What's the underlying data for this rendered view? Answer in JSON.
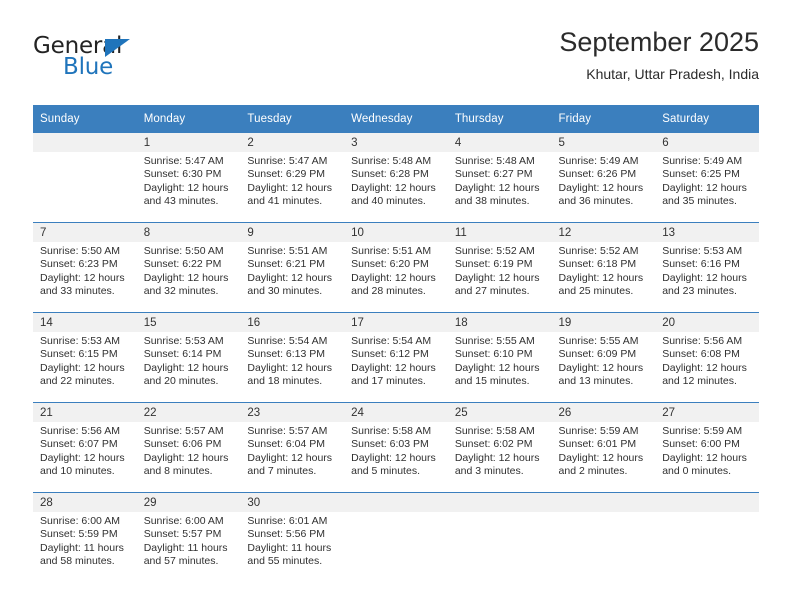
{
  "brand": {
    "line1": "General",
    "line2": "Blue",
    "triangle_icon": "triangle-icon",
    "color_dark": "#232323",
    "color_blue": "#1f74bb"
  },
  "header": {
    "title": "September 2025",
    "subtitle": "Khutar, Uttar Pradesh, India"
  },
  "theme": {
    "header_blue": "#3b7fbe",
    "daynum_band": "#f1f1f1",
    "text": "#303030"
  },
  "calendar": {
    "weekday_headers": [
      "Sunday",
      "Monday",
      "Tuesday",
      "Wednesday",
      "Thursday",
      "Friday",
      "Saturday"
    ],
    "weeks": [
      [
        {
          "day": "",
          "sunrise": "",
          "sunset": "",
          "daylight_1": "",
          "daylight_2": ""
        },
        {
          "day": "1",
          "sunrise": "Sunrise: 5:47 AM",
          "sunset": "Sunset: 6:30 PM",
          "daylight_1": "Daylight: 12 hours",
          "daylight_2": "and 43 minutes."
        },
        {
          "day": "2",
          "sunrise": "Sunrise: 5:47 AM",
          "sunset": "Sunset: 6:29 PM",
          "daylight_1": "Daylight: 12 hours",
          "daylight_2": "and 41 minutes."
        },
        {
          "day": "3",
          "sunrise": "Sunrise: 5:48 AM",
          "sunset": "Sunset: 6:28 PM",
          "daylight_1": "Daylight: 12 hours",
          "daylight_2": "and 40 minutes."
        },
        {
          "day": "4",
          "sunrise": "Sunrise: 5:48 AM",
          "sunset": "Sunset: 6:27 PM",
          "daylight_1": "Daylight: 12 hours",
          "daylight_2": "and 38 minutes."
        },
        {
          "day": "5",
          "sunrise": "Sunrise: 5:49 AM",
          "sunset": "Sunset: 6:26 PM",
          "daylight_1": "Daylight: 12 hours",
          "daylight_2": "and 36 minutes."
        },
        {
          "day": "6",
          "sunrise": "Sunrise: 5:49 AM",
          "sunset": "Sunset: 6:25 PM",
          "daylight_1": "Daylight: 12 hours",
          "daylight_2": "and 35 minutes."
        }
      ],
      [
        {
          "day": "7",
          "sunrise": "Sunrise: 5:50 AM",
          "sunset": "Sunset: 6:23 PM",
          "daylight_1": "Daylight: 12 hours",
          "daylight_2": "and 33 minutes."
        },
        {
          "day": "8",
          "sunrise": "Sunrise: 5:50 AM",
          "sunset": "Sunset: 6:22 PM",
          "daylight_1": "Daylight: 12 hours",
          "daylight_2": "and 32 minutes."
        },
        {
          "day": "9",
          "sunrise": "Sunrise: 5:51 AM",
          "sunset": "Sunset: 6:21 PM",
          "daylight_1": "Daylight: 12 hours",
          "daylight_2": "and 30 minutes."
        },
        {
          "day": "10",
          "sunrise": "Sunrise: 5:51 AM",
          "sunset": "Sunset: 6:20 PM",
          "daylight_1": "Daylight: 12 hours",
          "daylight_2": "and 28 minutes."
        },
        {
          "day": "11",
          "sunrise": "Sunrise: 5:52 AM",
          "sunset": "Sunset: 6:19 PM",
          "daylight_1": "Daylight: 12 hours",
          "daylight_2": "and 27 minutes."
        },
        {
          "day": "12",
          "sunrise": "Sunrise: 5:52 AM",
          "sunset": "Sunset: 6:18 PM",
          "daylight_1": "Daylight: 12 hours",
          "daylight_2": "and 25 minutes."
        },
        {
          "day": "13",
          "sunrise": "Sunrise: 5:53 AM",
          "sunset": "Sunset: 6:16 PM",
          "daylight_1": "Daylight: 12 hours",
          "daylight_2": "and 23 minutes."
        }
      ],
      [
        {
          "day": "14",
          "sunrise": "Sunrise: 5:53 AM",
          "sunset": "Sunset: 6:15 PM",
          "daylight_1": "Daylight: 12 hours",
          "daylight_2": "and 22 minutes."
        },
        {
          "day": "15",
          "sunrise": "Sunrise: 5:53 AM",
          "sunset": "Sunset: 6:14 PM",
          "daylight_1": "Daylight: 12 hours",
          "daylight_2": "and 20 minutes."
        },
        {
          "day": "16",
          "sunrise": "Sunrise: 5:54 AM",
          "sunset": "Sunset: 6:13 PM",
          "daylight_1": "Daylight: 12 hours",
          "daylight_2": "and 18 minutes."
        },
        {
          "day": "17",
          "sunrise": "Sunrise: 5:54 AM",
          "sunset": "Sunset: 6:12 PM",
          "daylight_1": "Daylight: 12 hours",
          "daylight_2": "and 17 minutes."
        },
        {
          "day": "18",
          "sunrise": "Sunrise: 5:55 AM",
          "sunset": "Sunset: 6:10 PM",
          "daylight_1": "Daylight: 12 hours",
          "daylight_2": "and 15 minutes."
        },
        {
          "day": "19",
          "sunrise": "Sunrise: 5:55 AM",
          "sunset": "Sunset: 6:09 PM",
          "daylight_1": "Daylight: 12 hours",
          "daylight_2": "and 13 minutes."
        },
        {
          "day": "20",
          "sunrise": "Sunrise: 5:56 AM",
          "sunset": "Sunset: 6:08 PM",
          "daylight_1": "Daylight: 12 hours",
          "daylight_2": "and 12 minutes."
        }
      ],
      [
        {
          "day": "21",
          "sunrise": "Sunrise: 5:56 AM",
          "sunset": "Sunset: 6:07 PM",
          "daylight_1": "Daylight: 12 hours",
          "daylight_2": "and 10 minutes."
        },
        {
          "day": "22",
          "sunrise": "Sunrise: 5:57 AM",
          "sunset": "Sunset: 6:06 PM",
          "daylight_1": "Daylight: 12 hours",
          "daylight_2": "and 8 minutes."
        },
        {
          "day": "23",
          "sunrise": "Sunrise: 5:57 AM",
          "sunset": "Sunset: 6:04 PM",
          "daylight_1": "Daylight: 12 hours",
          "daylight_2": "and 7 minutes."
        },
        {
          "day": "24",
          "sunrise": "Sunrise: 5:58 AM",
          "sunset": "Sunset: 6:03 PM",
          "daylight_1": "Daylight: 12 hours",
          "daylight_2": "and 5 minutes."
        },
        {
          "day": "25",
          "sunrise": "Sunrise: 5:58 AM",
          "sunset": "Sunset: 6:02 PM",
          "daylight_1": "Daylight: 12 hours",
          "daylight_2": "and 3 minutes."
        },
        {
          "day": "26",
          "sunrise": "Sunrise: 5:59 AM",
          "sunset": "Sunset: 6:01 PM",
          "daylight_1": "Daylight: 12 hours",
          "daylight_2": "and 2 minutes."
        },
        {
          "day": "27",
          "sunrise": "Sunrise: 5:59 AM",
          "sunset": "Sunset: 6:00 PM",
          "daylight_1": "Daylight: 12 hours",
          "daylight_2": "and 0 minutes."
        }
      ],
      [
        {
          "day": "28",
          "sunrise": "Sunrise: 6:00 AM",
          "sunset": "Sunset: 5:59 PM",
          "daylight_1": "Daylight: 11 hours",
          "daylight_2": "and 58 minutes."
        },
        {
          "day": "29",
          "sunrise": "Sunrise: 6:00 AM",
          "sunset": "Sunset: 5:57 PM",
          "daylight_1": "Daylight: 11 hours",
          "daylight_2": "and 57 minutes."
        },
        {
          "day": "30",
          "sunrise": "Sunrise: 6:01 AM",
          "sunset": "Sunset: 5:56 PM",
          "daylight_1": "Daylight: 11 hours",
          "daylight_2": "and 55 minutes."
        },
        {
          "day": "",
          "sunrise": "",
          "sunset": "",
          "daylight_1": "",
          "daylight_2": ""
        },
        {
          "day": "",
          "sunrise": "",
          "sunset": "",
          "daylight_1": "",
          "daylight_2": ""
        },
        {
          "day": "",
          "sunrise": "",
          "sunset": "",
          "daylight_1": "",
          "daylight_2": ""
        },
        {
          "day": "",
          "sunrise": "",
          "sunset": "",
          "daylight_1": "",
          "daylight_2": ""
        }
      ]
    ]
  }
}
